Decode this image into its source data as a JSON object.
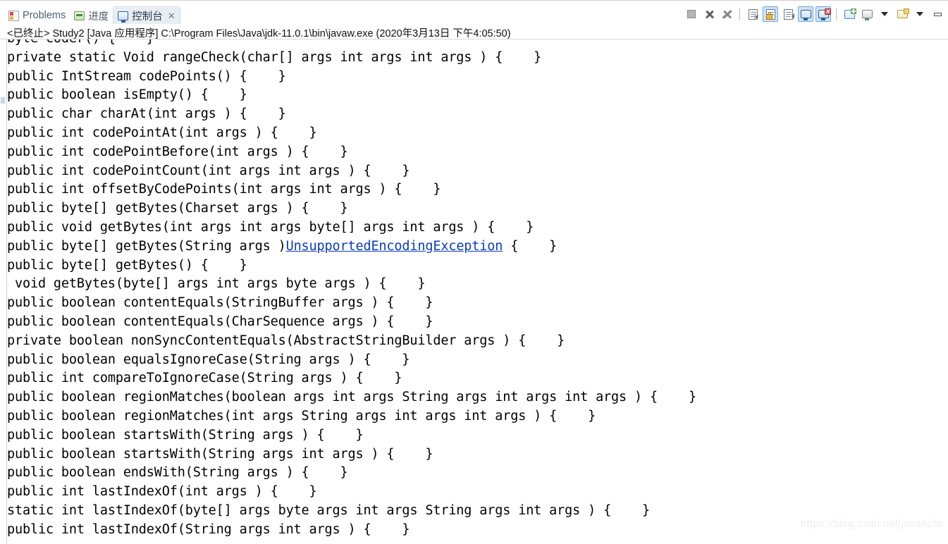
{
  "window": {
    "tabs": [
      {
        "label": "Problems",
        "icon": "problems-icon",
        "active": false
      },
      {
        "label": "进度",
        "icon": "progress-icon",
        "active": false
      },
      {
        "label": "控制台",
        "icon": "console-icon",
        "active": true,
        "close": "✕"
      }
    ]
  },
  "toolbar": {
    "buttons": [
      {
        "name": "terminate-button",
        "icon": "stop-square-icon",
        "pressed": false
      },
      {
        "name": "remove-launch-button",
        "icon": "remove-x-icon",
        "pressed": false
      },
      {
        "name": "remove-all-terminated-button",
        "icon": "remove-all-x-icon",
        "pressed": false
      },
      {
        "name": "clear-console-button",
        "icon": "clear-console-icon",
        "pressed": false
      },
      {
        "name": "scroll-lock-button",
        "icon": "scroll-lock-icon",
        "pressed": true
      },
      {
        "name": "word-wrap-button",
        "icon": "word-wrap-icon",
        "pressed": false
      },
      {
        "name": "show-console-on-output-button",
        "icon": "console-output-icon",
        "pressed": true
      },
      {
        "name": "show-console-on-error-button",
        "icon": "console-error-icon",
        "pressed": true
      },
      {
        "name": "pin-console-button",
        "icon": "pin-console-icon",
        "pressed": false
      },
      {
        "name": "display-selected-console-button",
        "icon": "display-console-icon",
        "pressed": false
      },
      {
        "name": "display-selected-console-dropdown",
        "icon": "chevron-down-icon",
        "pressed": false
      },
      {
        "name": "open-console-button",
        "icon": "open-console-icon",
        "pressed": false
      },
      {
        "name": "open-console-dropdown",
        "icon": "chevron-down-icon",
        "pressed": false
      },
      {
        "name": "minimize-view-button",
        "icon": "minimize-icon",
        "pressed": false
      }
    ]
  },
  "console": {
    "header": "<已终止> Study2 [Java 应用程序] C:\\Program Files\\Java\\jdk-11.0.1\\bin\\javaw.exe  (2020年3月13日 下午4:05:50)",
    "lines": [
      "byte coder() {    }",
      "private static Void rangeCheck(char[] args int args int args ) {    }",
      "public IntStream codePoints() {    }",
      "public boolean isEmpty() {    }",
      "public char charAt(int args ) {    }",
      "public int codePointAt(int args ) {    }",
      "public int codePointBefore(int args ) {    }",
      "public int codePointCount(int args int args ) {    }",
      "public int offsetByCodePoints(int args int args ) {    }",
      "public byte[] getBytes(Charset args ) {    }",
      "public void getBytes(int args int args byte[] args int args ) {    }",
      null,
      "public byte[] getBytes() {    }",
      " void getBytes(byte[] args int args byte args ) {    }",
      "public boolean contentEquals(StringBuffer args ) {    }",
      "public boolean contentEquals(CharSequence args ) {    }",
      "private boolean nonSyncContentEquals(AbstractStringBuilder args ) {    }",
      "public boolean equalsIgnoreCase(String args ) {    }",
      "public int compareToIgnoreCase(String args ) {    }",
      "public boolean regionMatches(boolean args int args String args int args int args ) {    }",
      "public boolean regionMatches(int args String args int args int args ) {    }",
      "public boolean startsWith(String args ) {    }",
      "public boolean startsWith(String args int args ) {    }",
      "public boolean endsWith(String args ) {    }",
      "public int lastIndexOf(int args ) {    }",
      "static int lastIndexOf(byte[] args byte args int args String args int args ) {    }",
      "public int lastIndexOf(String args int args ) {    }"
    ],
    "link_line": {
      "prefix": "public byte[] getBytes(String args )",
      "link": "UnsupportedEncodingException",
      "suffix": " {    }"
    }
  },
  "watermark": "https://blog.csdn.net/javanofa"
}
